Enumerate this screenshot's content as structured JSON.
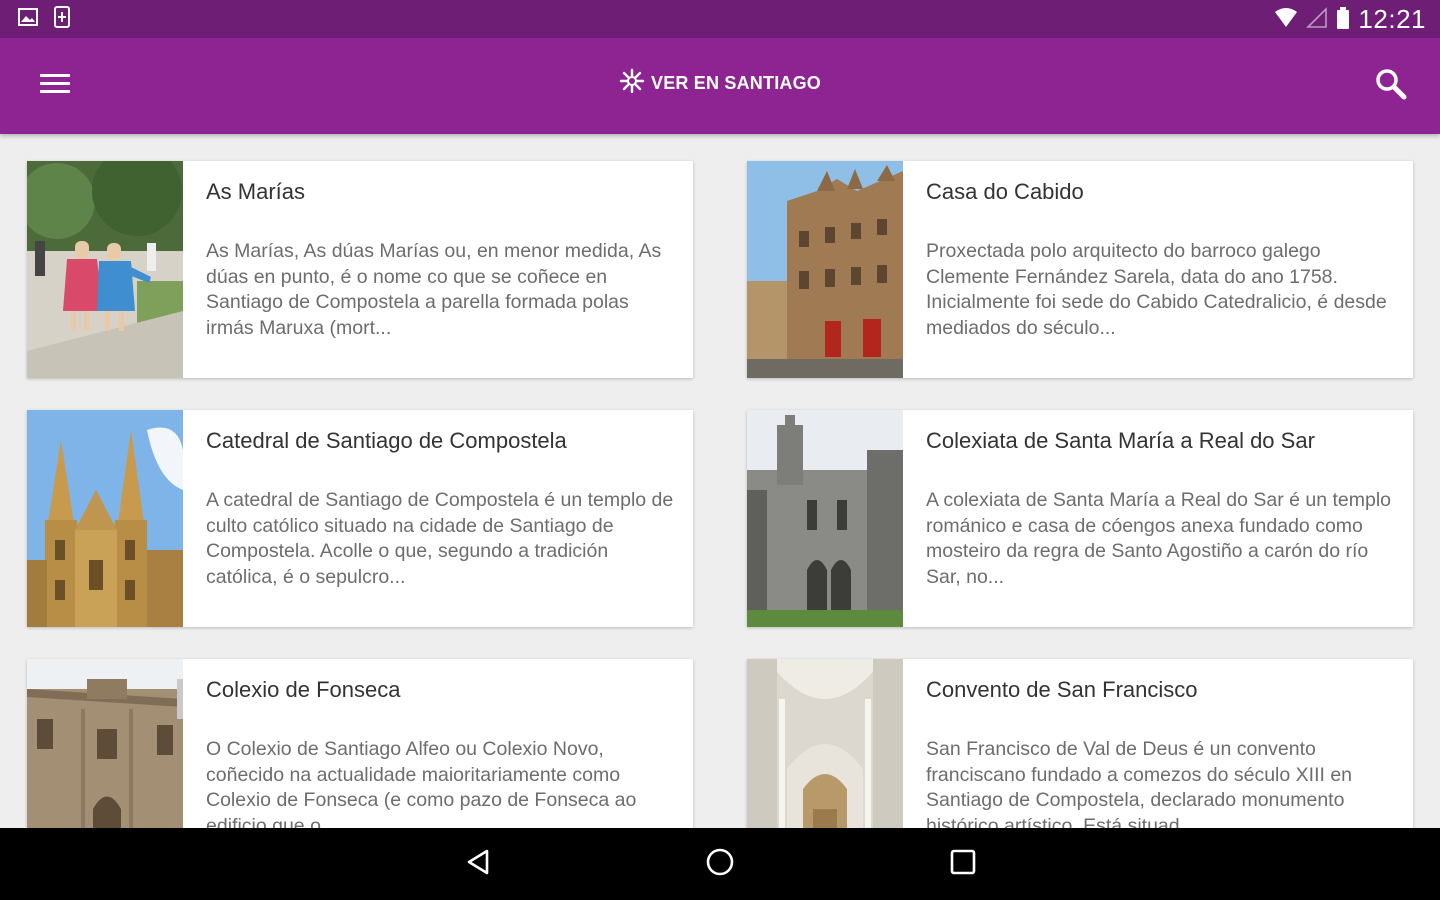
{
  "status_bar": {
    "time": "12:21",
    "left_icons": [
      "image-notification-icon",
      "phone-notification-icon"
    ],
    "right_icons": [
      "wifi-icon",
      "signal-icon",
      "battery-icon"
    ]
  },
  "app_bar": {
    "title": "VER EN SANTIAGO",
    "menu_icon": "hamburger-menu-icon",
    "search_icon": "search-icon",
    "color": "#8e2492"
  },
  "colors": {
    "status_bar": "#6e1f75",
    "app_bar": "#8e2492",
    "background": "#eeeeee",
    "card": "#ffffff",
    "title_text": "#333333",
    "desc_text": "#6d6d6d"
  },
  "places": [
    {
      "title": "As Marías",
      "description": "As Marías, As dúas Marías ou, en menor medida, As dúas en punto, é o nome co que se coñece en Santiago de Compostela a parella formada polas irmás Maruxa (mort..."
    },
    {
      "title": "Casa do Cabido",
      "description": "Proxectada polo arquitecto do barroco galego Clemente Fernández Sarela, data do ano 1758. Inicialmente foi sede do Cabido Catedralicio, é desde mediados do século..."
    },
    {
      "title": "Catedral de Santiago de Compostela",
      "description": "A catedral de Santiago de Compostela é un templo de culto católico situado na cidade de Santiago de Compostela. Acolle o que, segundo a tradición católica, é o sepulcro..."
    },
    {
      "title": "Colexiata de Santa María a Real do Sar",
      "description": "A colexiata de Santa María a Real do Sar é un templo románico e casa de cóengos anexa fundado como mosteiro da regra de Santo Agostiño a carón do río Sar, no..."
    },
    {
      "title": "Colexio de Fonseca",
      "description": "O Colexio de Santiago Alfeo ou Colexio Novo, coñecido na actualidade maioritariamente como Colexio de Fonseca (e como pazo de Fonseca ao edificio que o"
    },
    {
      "title": "Convento de San Francisco",
      "description": "San Francisco de Val de Deus é un convento franciscano fundado a comezos do século XIII en Santiago de Compostela, declarado monumento histórico artístico. Está situad"
    }
  ],
  "nav_bar": {
    "back_icon": "back-triangle-icon",
    "home_icon": "home-circle-icon",
    "recents_icon": "recents-square-icon"
  }
}
